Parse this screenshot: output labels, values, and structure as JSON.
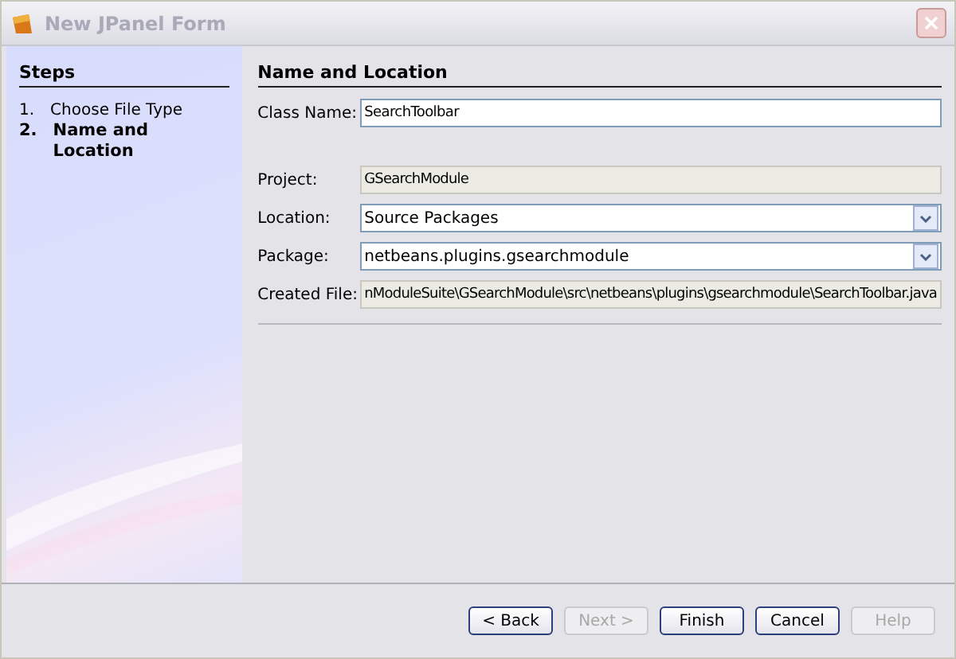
{
  "window": {
    "title": "New JPanel Form"
  },
  "steps": {
    "title": "Steps",
    "items": [
      {
        "number": "1.",
        "label": "Choose File Type",
        "selected": false
      },
      {
        "number": "2.",
        "label": "Name and Location",
        "selected": true
      }
    ]
  },
  "panel": {
    "title": "Name and Location",
    "fields": [
      {
        "kind": "text",
        "label": "Class Name:",
        "value": "SearchToolbar"
      },
      {
        "kind": "gap"
      },
      {
        "kind": "readonly",
        "label": "Project:",
        "value": "GSearchModule"
      },
      {
        "kind": "combo",
        "label": "Location:",
        "value": "Source Packages"
      },
      {
        "kind": "combo",
        "label": "Package:",
        "value": "netbeans.plugins.gsearchmodule"
      },
      {
        "kind": "readonly",
        "label": "Created File:",
        "value": "nModuleSuite\\GSearchModule\\src\\netbeans\\plugins\\gsearchmodule\\SearchToolbar.java"
      }
    ]
  },
  "buttons": [
    {
      "label": "< Back",
      "disabled": false
    },
    {
      "label": "Next >",
      "disabled": true
    },
    {
      "label": "Finish",
      "disabled": false
    },
    {
      "label": "Cancel",
      "disabled": false
    },
    {
      "label": "Help",
      "disabled": true
    }
  ]
}
